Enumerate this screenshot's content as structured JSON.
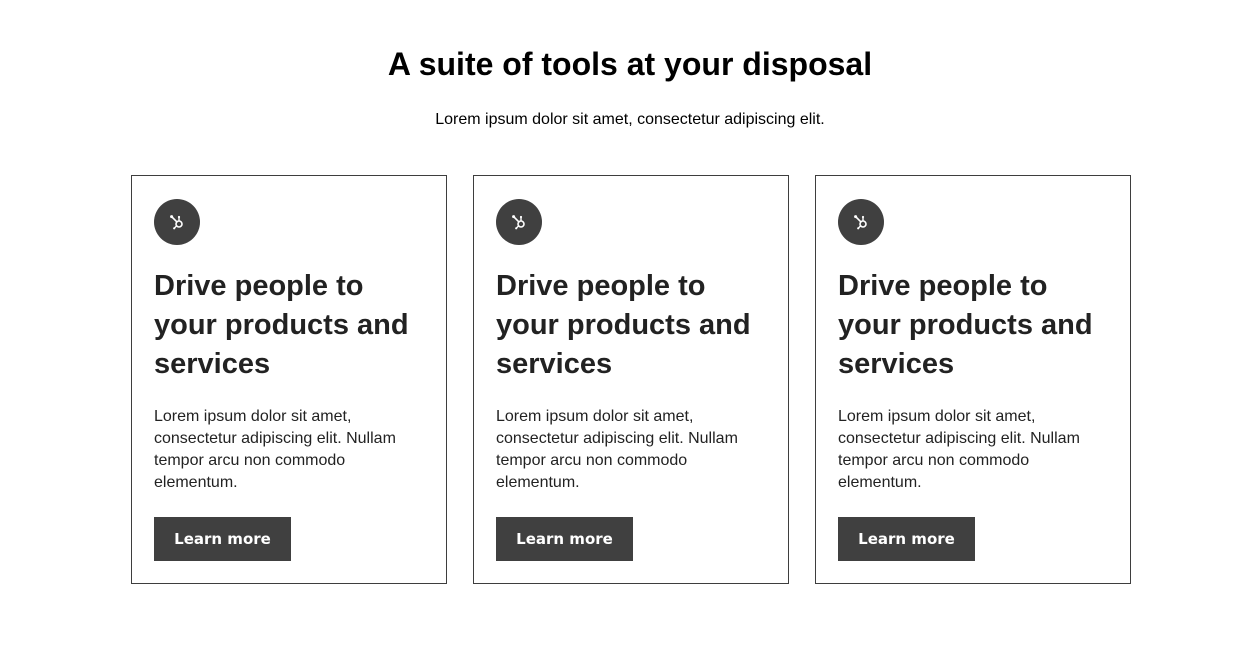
{
  "section": {
    "title": "A suite of tools at your disposal",
    "subtitle": "Lorem ipsum dolor sit amet, consectetur adipiscing elit."
  },
  "cards": [
    {
      "icon": "hubspot-sprocket-icon",
      "title": "Drive people to your products and services",
      "body": "Lorem ipsum dolor sit amet, consectetur adipiscing elit. Nullam tempor arcu non commodo elementum.",
      "button_label": "Learn more"
    },
    {
      "icon": "hubspot-sprocket-icon",
      "title": "Drive people to your products and services",
      "body": "Lorem ipsum dolor sit amet, consectetur adipiscing elit. Nullam tempor arcu non commodo elementum.",
      "button_label": "Learn more"
    },
    {
      "icon": "hubspot-sprocket-icon",
      "title": "Drive people to your products and services",
      "body": "Lorem ipsum dolor sit amet, consectetur adipiscing elit. Nullam tempor arcu non commodo elementum.",
      "button_label": "Learn more"
    }
  ],
  "colors": {
    "button_bg": "#404040",
    "icon_bg": "#404040",
    "card_border": "#3e3e3e",
    "text": "#222222"
  }
}
